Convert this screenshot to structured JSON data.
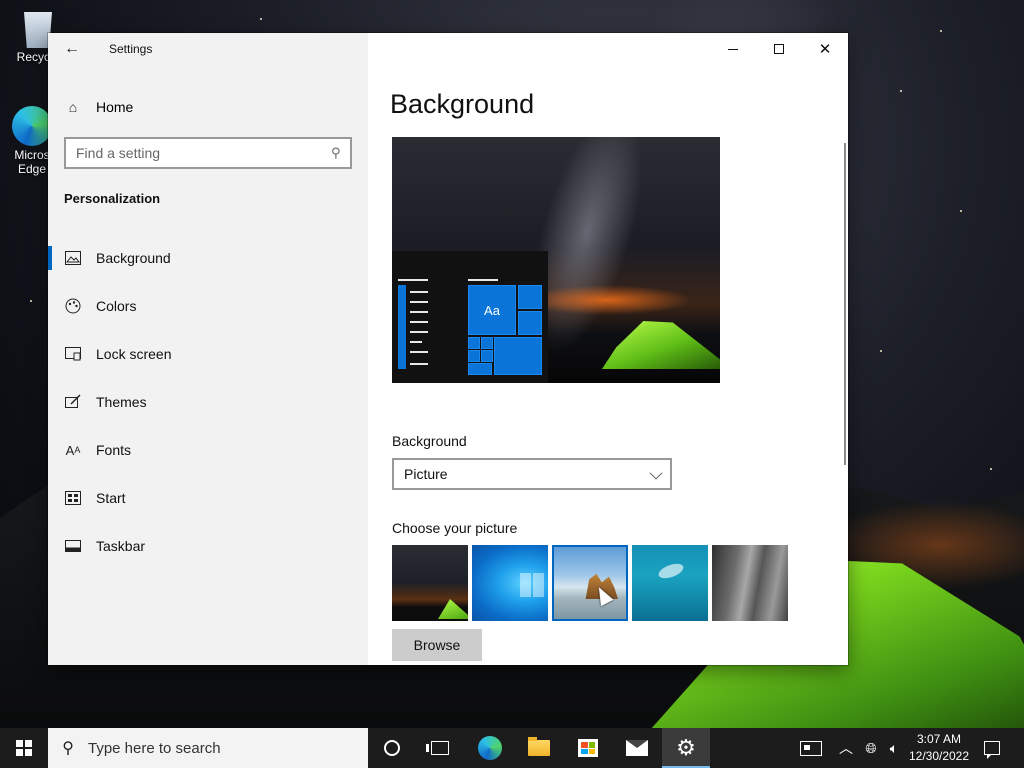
{
  "desktop": {
    "icons": [
      {
        "label": "Recycle",
        "icon": "recycle-bin-icon"
      },
      {
        "label": "Micros Edge",
        "icon": "edge-icon"
      }
    ]
  },
  "window": {
    "title": "Settings",
    "controls": {
      "minimize": "minimize-icon",
      "maximize": "maximize-icon",
      "close": "close-icon"
    }
  },
  "sidebar": {
    "home_label": "Home",
    "search_placeholder": "Find a setting",
    "section": "Personalization",
    "items": [
      {
        "label": "Background",
        "icon": "picture-icon",
        "active": true
      },
      {
        "label": "Colors",
        "icon": "palette-icon",
        "active": false
      },
      {
        "label": "Lock screen",
        "icon": "lock-screen-icon",
        "active": false
      },
      {
        "label": "Themes",
        "icon": "brush-icon",
        "active": false
      },
      {
        "label": "Fonts",
        "icon": "font-icon",
        "active": false
      },
      {
        "label": "Start",
        "icon": "start-icon",
        "active": false
      },
      {
        "label": "Taskbar",
        "icon": "taskbar-icon",
        "active": false
      }
    ]
  },
  "main": {
    "title": "Background",
    "preview_tile_label": "Aa",
    "background_label": "Background",
    "background_value": "Picture",
    "choose_label": "Choose your picture",
    "pictures": [
      "Milky way tent",
      "Windows blue",
      "Beach rocks",
      "Underwater swimmer",
      "Cliff rock"
    ],
    "selected_picture": 2,
    "browse_label": "Browse"
  },
  "taskbar": {
    "search_placeholder": "Type here to search",
    "pinned": [
      "cortana-icon",
      "task-view-icon",
      "edge-icon",
      "file-explorer-icon",
      "store-icon",
      "mail-icon",
      "settings-icon"
    ],
    "active": "settings-icon",
    "time": "3:07 AM",
    "date": "12/30/2022"
  },
  "colors": {
    "accent": "#0067c0",
    "sidebar_bg": "#f2f2f2",
    "taskbar_bg": "#1c1c1c"
  }
}
